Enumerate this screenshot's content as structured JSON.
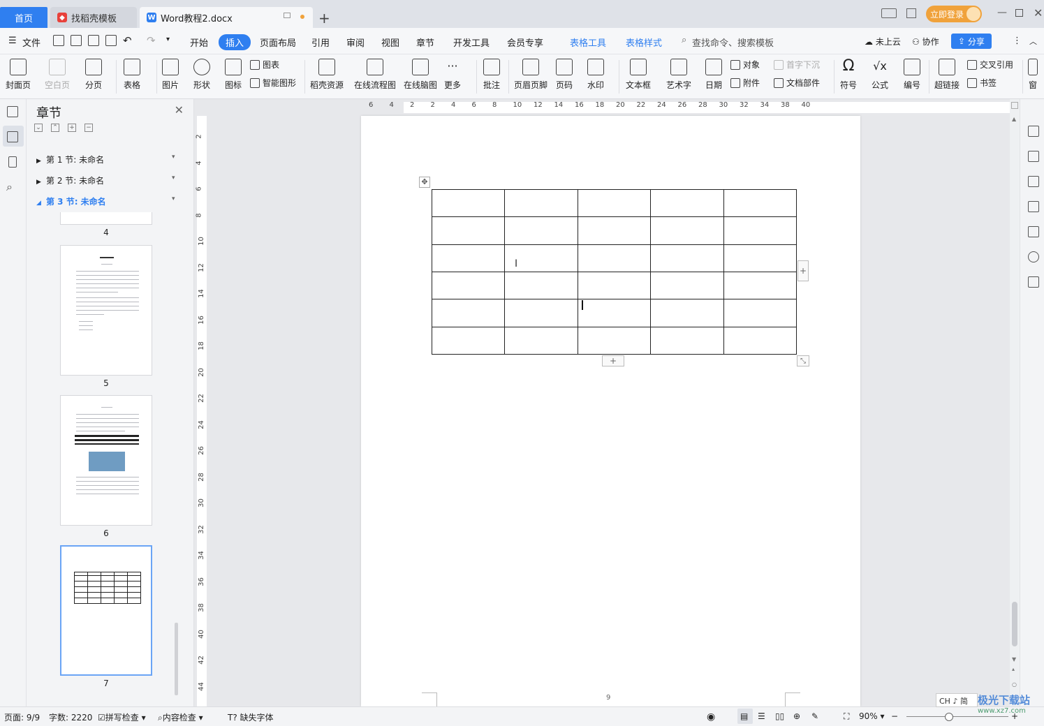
{
  "titlebar": {
    "tabs": [
      {
        "label": "首页"
      },
      {
        "label": "找稻壳模板"
      },
      {
        "label": "Word教程2.docx"
      }
    ],
    "login_label": "立即登录"
  },
  "menubar": {
    "file": "文件",
    "items": [
      "开始",
      "插入",
      "页面布局",
      "引用",
      "审阅",
      "视图",
      "章节",
      "开发工具",
      "会员专享"
    ],
    "context_tabs": [
      "表格工具",
      "表格样式"
    ],
    "search_placeholder": "查找命令、搜索模板",
    "cloud": "未上云",
    "collab": "协作",
    "share": "分享"
  },
  "ribbon": {
    "cover": "封面页",
    "blank": "空白页",
    "pagebreak": "分页",
    "table": "表格",
    "picture": "图片",
    "shape": "形状",
    "icon": "图标",
    "chart": "图表",
    "smartart": "智能图形",
    "daoke": "稻壳资源",
    "flowchart": "在线流程图",
    "mindmap": "在线脑图",
    "more": "更多",
    "comment": "批注",
    "header": "页眉页脚",
    "pagenum": "页码",
    "watermark": "水印",
    "textbox": "文本框",
    "wordart": "艺术字",
    "date": "日期",
    "object": "对象",
    "attach": "附件",
    "dropcap": "首字下沉",
    "docpart": "文档部件",
    "symbol": "符号",
    "formula": "公式",
    "numbering": "编号",
    "hyperlink": "超链接",
    "crossref": "交叉引用",
    "bookmark": "书签",
    "window": "窗"
  },
  "navpane": {
    "title": "章节",
    "sections": [
      {
        "label": "第 1 节: 未命名"
      },
      {
        "label": "第 2 节: 未命名"
      },
      {
        "label": "第 3 节: 未命名"
      }
    ],
    "pages": [
      "4",
      "5",
      "6",
      "7"
    ]
  },
  "ruler": {
    "h": [
      "6",
      "4",
      "2",
      "2",
      "4",
      "6",
      "8",
      "10",
      "12",
      "14",
      "16",
      "18",
      "20",
      "22",
      "24",
      "26",
      "28",
      "30",
      "32",
      "34",
      "38",
      "40"
    ],
    "v": [
      "2",
      "4",
      "6",
      "8",
      "10",
      "12",
      "14",
      "16",
      "18",
      "20",
      "22",
      "24",
      "26",
      "28",
      "30",
      "32",
      "34",
      "36",
      "38",
      "40",
      "42",
      "44"
    ]
  },
  "document": {
    "table": {
      "rows": 6,
      "cols": 5
    },
    "footer_page": "9"
  },
  "statusbar": {
    "page": "页面: 9/9",
    "words": "字数: 2220",
    "spell": "拼写检查",
    "content": "内容检查",
    "missing_font": "缺失字体",
    "zoom": "90%"
  },
  "ime": "CH ♪ 简",
  "watermark_logo": "极光下载站 www.xz7.com",
  "colors": {
    "accent": "#2f7ff0",
    "login": "#f0a23b"
  }
}
